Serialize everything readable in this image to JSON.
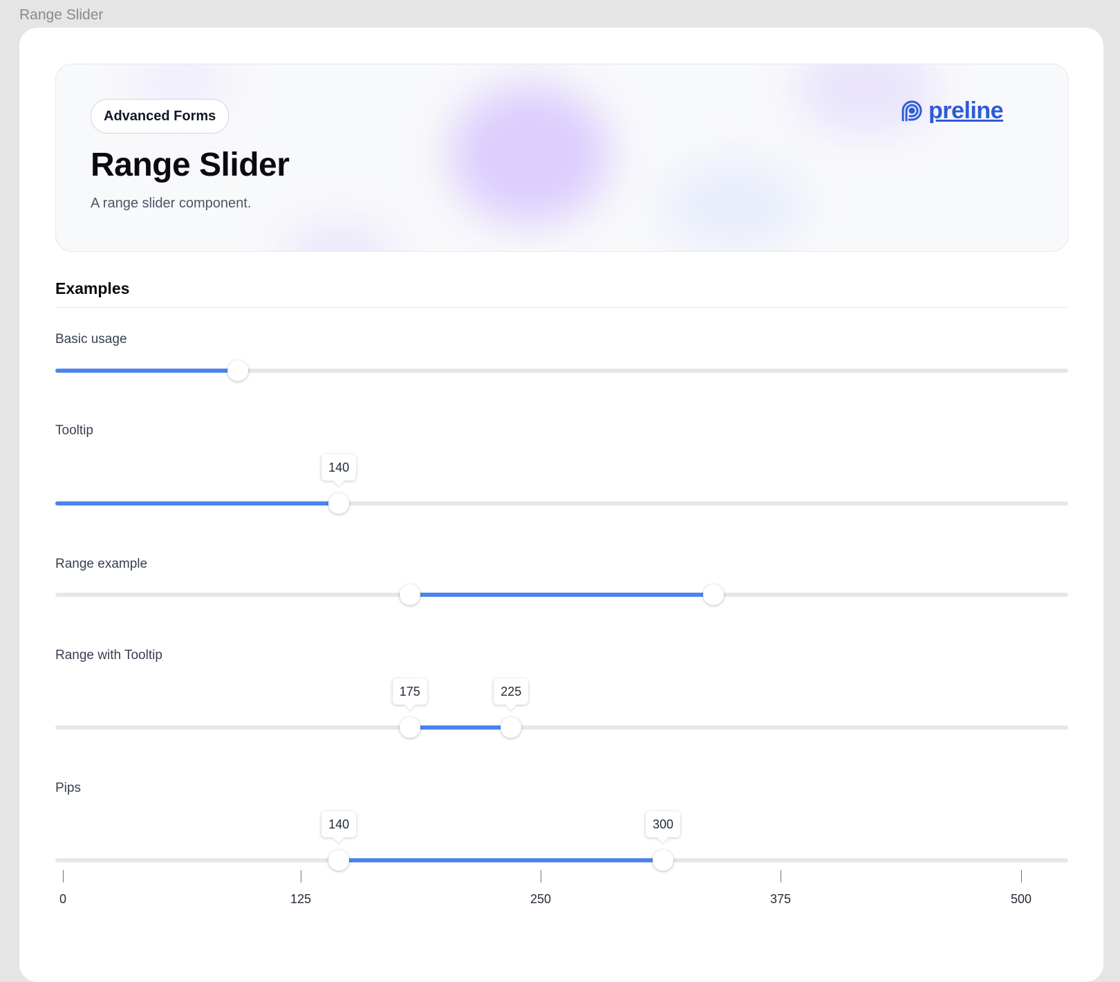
{
  "window": {
    "title": "Range Slider"
  },
  "hero": {
    "badge": "Advanced Forms",
    "title": "Range Slider",
    "description": "A range slider component.",
    "logo_text": "preline",
    "logo_icon": "preline-logo-icon"
  },
  "section": {
    "title": "Examples"
  },
  "colors": {
    "accent": "#4b84ee",
    "track": "#e5e7eb",
    "logo": "#2d5bd8"
  },
  "examples": [
    {
      "label": "Basic usage",
      "min": 0,
      "max": 100,
      "values": [
        18
      ],
      "tooltips": false
    },
    {
      "label": "Tooltip",
      "min": 0,
      "max": 500,
      "values": [
        140
      ],
      "tooltips": true,
      "tooltip_values": [
        "140"
      ]
    },
    {
      "label": "Range example",
      "min": 0,
      "max": 100,
      "values": [
        35,
        65
      ],
      "tooltips": false
    },
    {
      "label": "Range with Tooltip",
      "min": 0,
      "max": 500,
      "values": [
        175,
        225
      ],
      "tooltips": true,
      "tooltip_values": [
        "175",
        "225"
      ]
    },
    {
      "label": "Pips",
      "min": 0,
      "max": 500,
      "values": [
        140,
        300
      ],
      "tooltips": true,
      "tooltip_values": [
        "140",
        "300"
      ],
      "pips": [
        "0",
        "125",
        "250",
        "375",
        "500"
      ]
    }
  ]
}
